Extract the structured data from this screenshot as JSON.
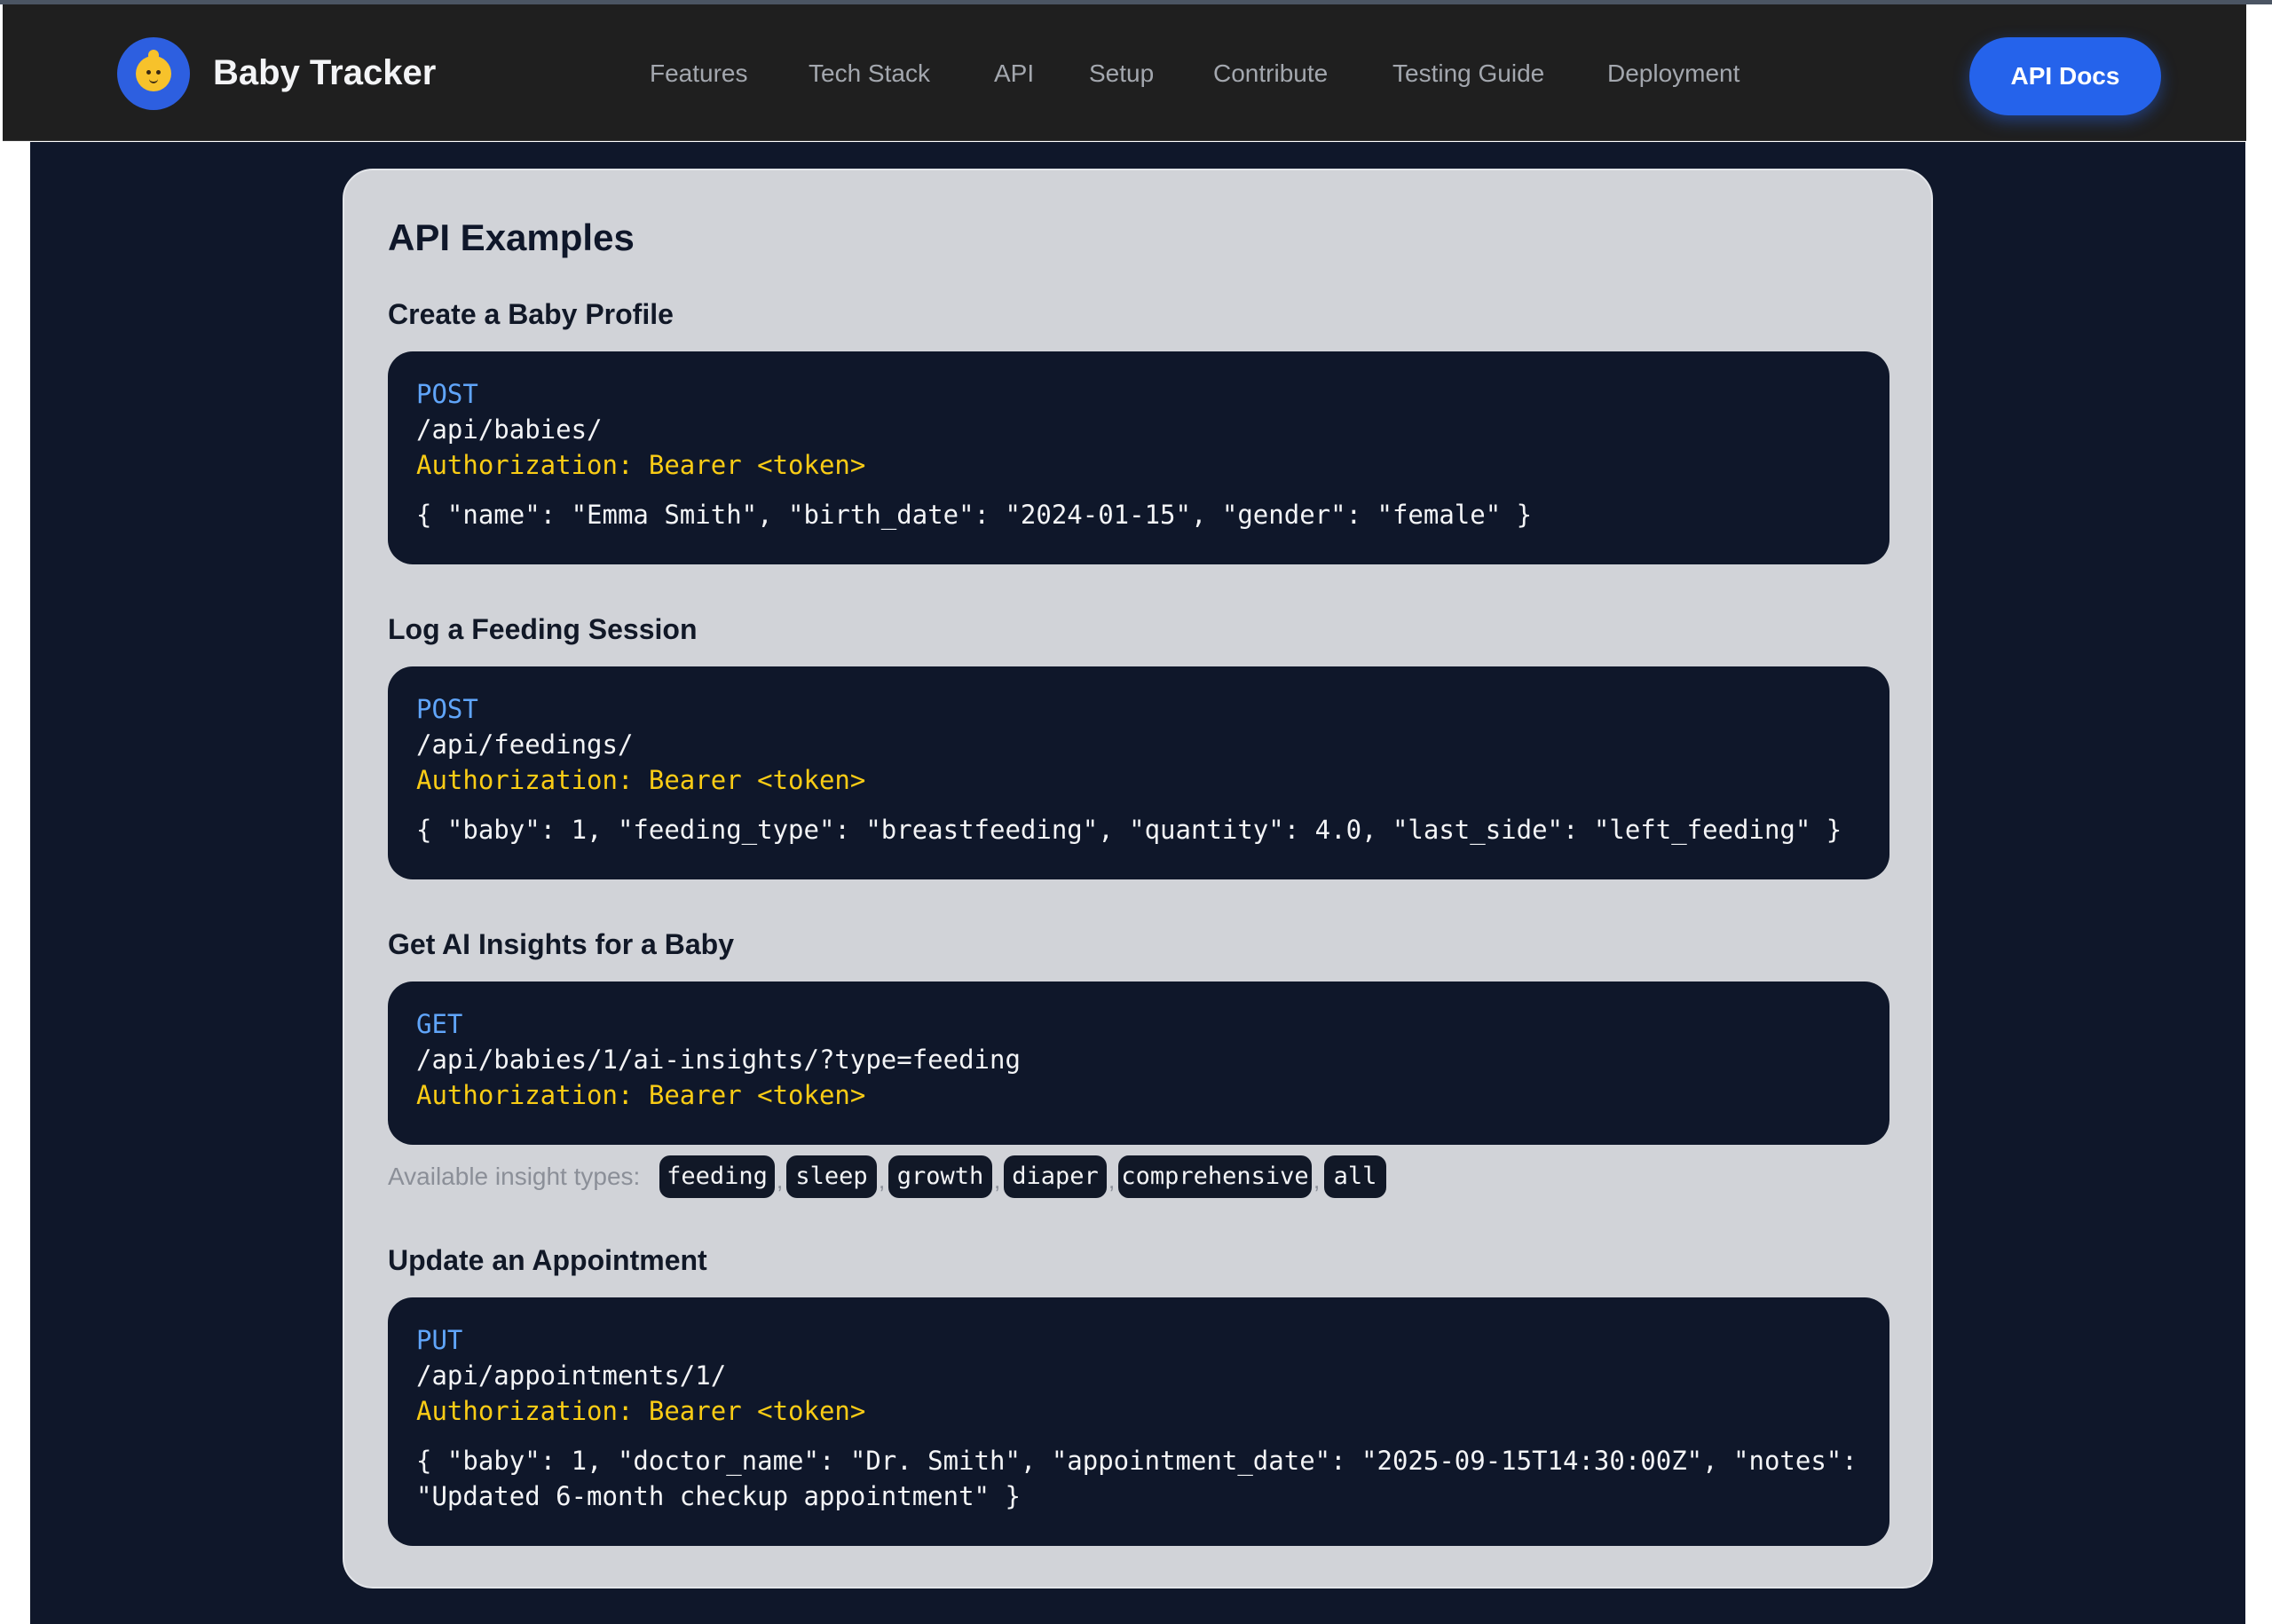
{
  "header": {
    "brand": "Baby Tracker",
    "logo_icon": "baby-face-icon",
    "nav": [
      {
        "label": "Features"
      },
      {
        "label": "Tech Stack"
      },
      {
        "label": "API"
      },
      {
        "label": "Setup"
      },
      {
        "label": "Contribute"
      },
      {
        "label": "Testing Guide"
      },
      {
        "label": "Deployment"
      }
    ],
    "cta_label": "API Docs"
  },
  "colors": {
    "accent": "#2563eb",
    "method": "#60a5fa",
    "auth": "#facc15",
    "code_bg": "#0f172a",
    "card_bg": "#d1d3d8"
  },
  "api_examples": {
    "title": "API Examples",
    "sections": [
      {
        "title": "Create a Baby Profile",
        "method": "POST",
        "path": "/api/babies/",
        "auth": "Authorization: Bearer <token>",
        "body_lines": [
          "{ \"name\": \"Emma Smith\", \"birth_date\": \"2024-01-15\", \"gender\": \"female\" }"
        ]
      },
      {
        "title": "Log a Feeding Session",
        "method": "POST",
        "path": "/api/feedings/",
        "auth": "Authorization: Bearer <token>",
        "body_lines": [
          "{ \"baby\": 1, \"feeding_type\": \"breastfeeding\", \"quantity\": 4.0, \"last_side\": \"left_feeding\" }"
        ]
      },
      {
        "title": "Get AI Insights for a Baby",
        "method": "GET",
        "path": "/api/babies/1/ai-insights/?type=feeding",
        "auth": "Authorization: Bearer <token>",
        "body_lines": []
      },
      {
        "title": "Update an Appointment",
        "method": "PUT",
        "path": "/api/appointments/1/",
        "auth": "Authorization: Bearer <token>",
        "body_lines": [
          "{ \"baby\": 1, \"doctor_name\": \"Dr. Smith\", \"appointment_date\": \"2025-09-15T14:30:00Z\", \"notes\":",
          "\"Updated 6-month checkup appointment\" }"
        ]
      }
    ],
    "insight_types": {
      "label": "Available insight types:",
      "separator": ",",
      "types": [
        "feeding",
        "sleep",
        "growth",
        "diaper",
        "comprehensive",
        "all"
      ]
    }
  }
}
